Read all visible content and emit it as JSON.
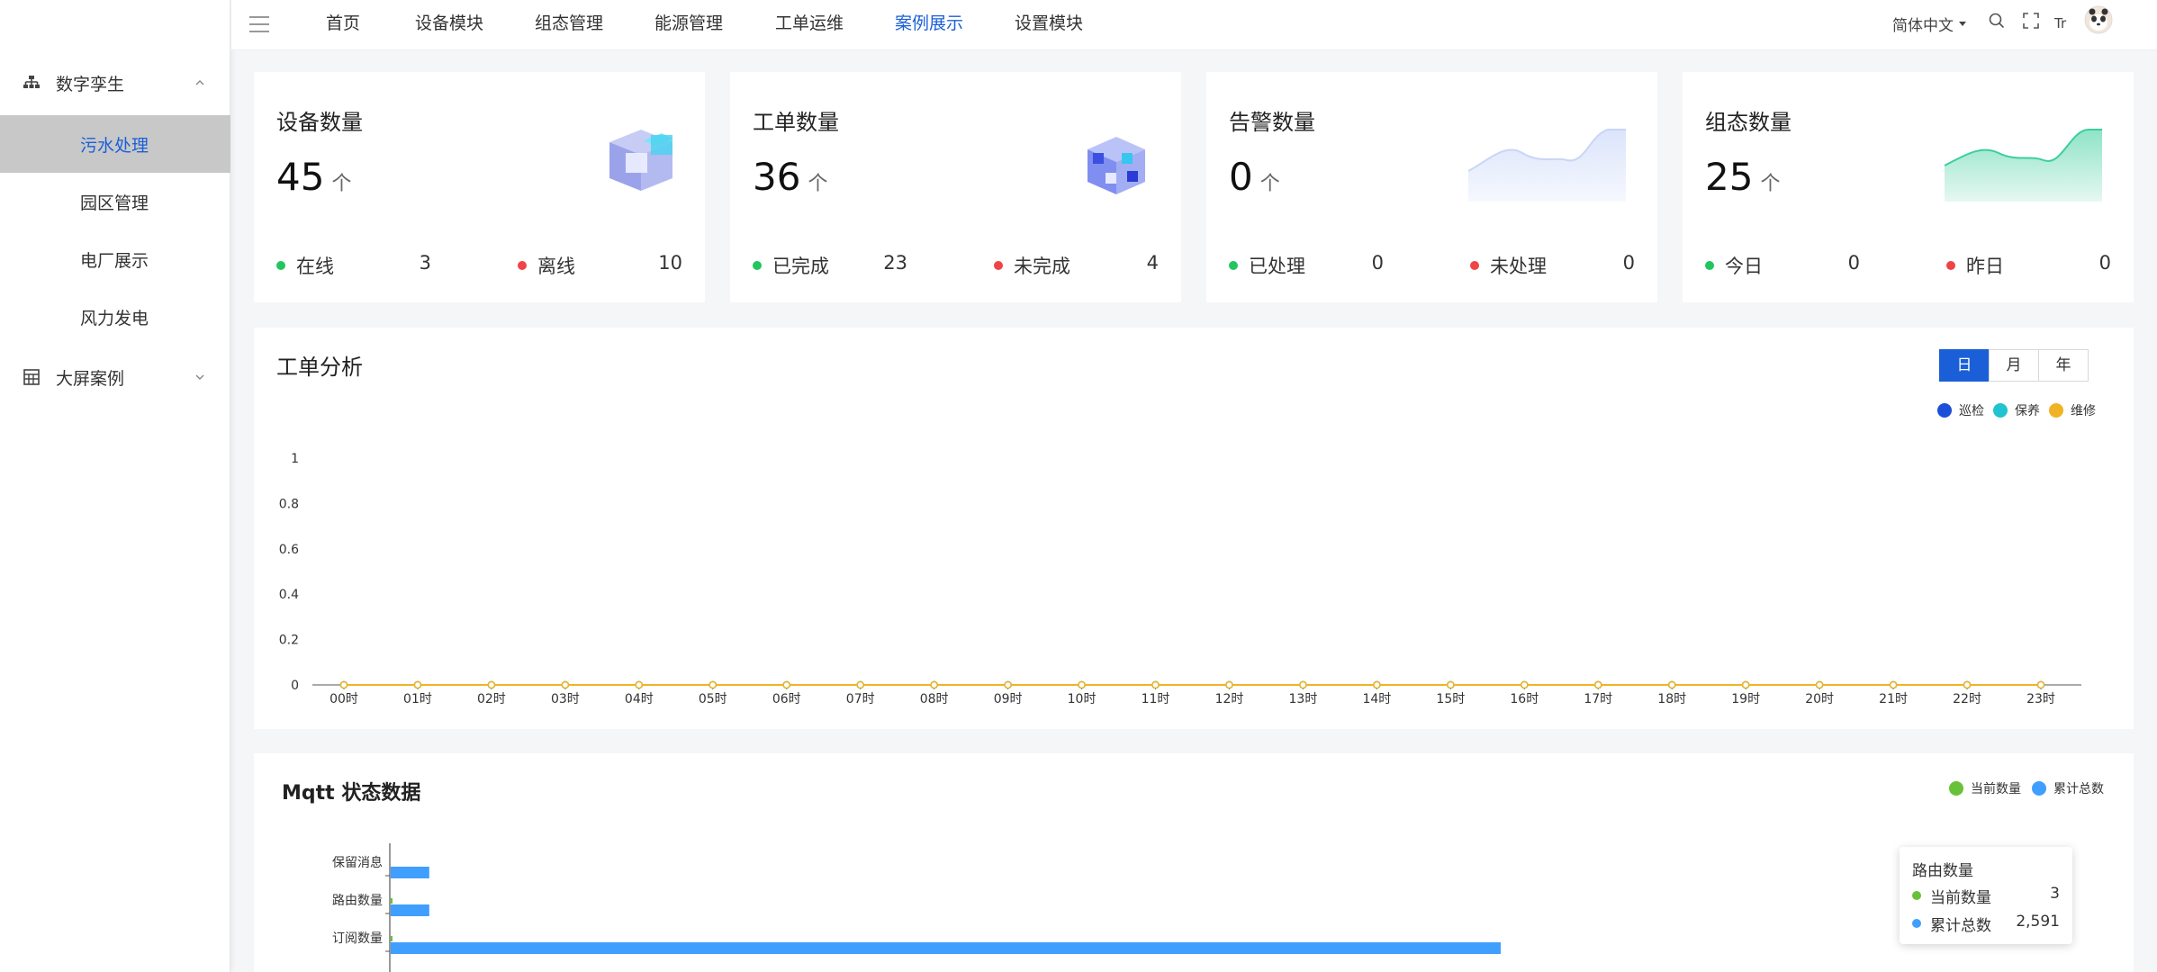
{
  "sidebar": {
    "groups": [
      {
        "label": "数字孪生",
        "icon": "sitemap-icon"
      },
      {
        "label": "大屏案例",
        "icon": "grid-icon"
      }
    ],
    "items": [
      {
        "label": "污水处理",
        "active": true
      },
      {
        "label": "园区管理"
      },
      {
        "label": "电厂展示"
      },
      {
        "label": "风力发电"
      }
    ]
  },
  "topbar": {
    "nav": [
      "首页",
      "设备模块",
      "组态管理",
      "能源管理",
      "工单运维",
      "案例展示",
      "设置模块"
    ],
    "active_nav": "案例展示",
    "language": "简体中文",
    "icons": [
      "search-icon",
      "fullscreen-icon",
      "font-size-icon",
      "avatar"
    ],
    "font_icon_text": "Tr"
  },
  "cards": [
    {
      "title": "设备数量",
      "value": "45",
      "unit": "个",
      "stat1_label": "在线",
      "stat1_value": "3",
      "stat2_label": "离线",
      "stat2_value": "10"
    },
    {
      "title": "工单数量",
      "value": "36",
      "unit": "个",
      "stat1_label": "已完成",
      "stat1_value": "23",
      "stat2_label": "未完成",
      "stat2_value": "4"
    },
    {
      "title": "告警数量",
      "value": "0",
      "unit": "个",
      "stat1_label": "已处理",
      "stat1_value": "0",
      "stat2_label": "未处理",
      "stat2_value": "0"
    },
    {
      "title": "组态数量",
      "value": "25",
      "unit": "个",
      "stat1_label": "今日",
      "stat1_value": "0",
      "stat2_label": "昨日",
      "stat2_value": "0"
    }
  ],
  "colors": {
    "accent": "#1a5fd8",
    "green": "#22c55e",
    "red": "#ef4444",
    "line": "#f0b323",
    "bar": "#409eff",
    "legend_green": "#67c23a"
  },
  "work_order": {
    "title": "工单分析",
    "tabs": [
      "日",
      "月",
      "年"
    ],
    "active_tab": "日",
    "legend": [
      {
        "name": "巡检",
        "color": "#1a4fd8"
      },
      {
        "name": "保养",
        "color": "#22c3d1"
      },
      {
        "name": "维修",
        "color": "#f0b323"
      }
    ]
  },
  "mqtt": {
    "title": "Mqtt 状态数据",
    "legend": [
      {
        "name": "当前数量",
        "color": "#67c23a"
      },
      {
        "name": "累计总数",
        "color": "#409eff"
      }
    ],
    "tooltip": {
      "title": "路由数量",
      "rows": [
        {
          "label": "当前数量",
          "value": "3"
        },
        {
          "label": "累计总数",
          "value": "2,591"
        }
      ]
    }
  },
  "chart_data": [
    {
      "type": "line",
      "title": "工单分析",
      "x": [
        "00时",
        "01时",
        "02时",
        "03时",
        "04时",
        "05时",
        "06时",
        "07时",
        "08时",
        "09时",
        "10时",
        "11时",
        "12时",
        "13时",
        "14时",
        "15时",
        "16时",
        "17时",
        "18时",
        "19时",
        "20时",
        "21时",
        "22时",
        "23时"
      ],
      "ylim": [
        0,
        1
      ],
      "yticks": [
        "1",
        "0.8",
        "0.6",
        "0.4",
        "0.2",
        "0"
      ],
      "series": [
        {
          "name": "巡检",
          "values": [
            0,
            0,
            0,
            0,
            0,
            0,
            0,
            0,
            0,
            0,
            0,
            0,
            0,
            0,
            0,
            0,
            0,
            0,
            0,
            0,
            0,
            0,
            0,
            0
          ]
        },
        {
          "name": "保养",
          "values": [
            0,
            0,
            0,
            0,
            0,
            0,
            0,
            0,
            0,
            0,
            0,
            0,
            0,
            0,
            0,
            0,
            0,
            0,
            0,
            0,
            0,
            0,
            0,
            0
          ]
        },
        {
          "name": "维修",
          "values": [
            0,
            0,
            0,
            0,
            0,
            0,
            0,
            0,
            0,
            0,
            0,
            0,
            0,
            0,
            0,
            0,
            0,
            0,
            0,
            0,
            0,
            0,
            0,
            0
          ]
        }
      ],
      "grid": false,
      "legend": "top-right"
    },
    {
      "type": "bar",
      "orientation": "horizontal",
      "title": "Mqtt 状态数据",
      "categories": [
        "保留消息",
        "路由数量",
        "订阅数量"
      ],
      "series": [
        {
          "name": "当前数量",
          "values": [
            0,
            3,
            3
          ]
        },
        {
          "name": "累计总数",
          "values": [
            90,
            90,
            2591
          ]
        }
      ],
      "legend": "top-right"
    }
  ]
}
